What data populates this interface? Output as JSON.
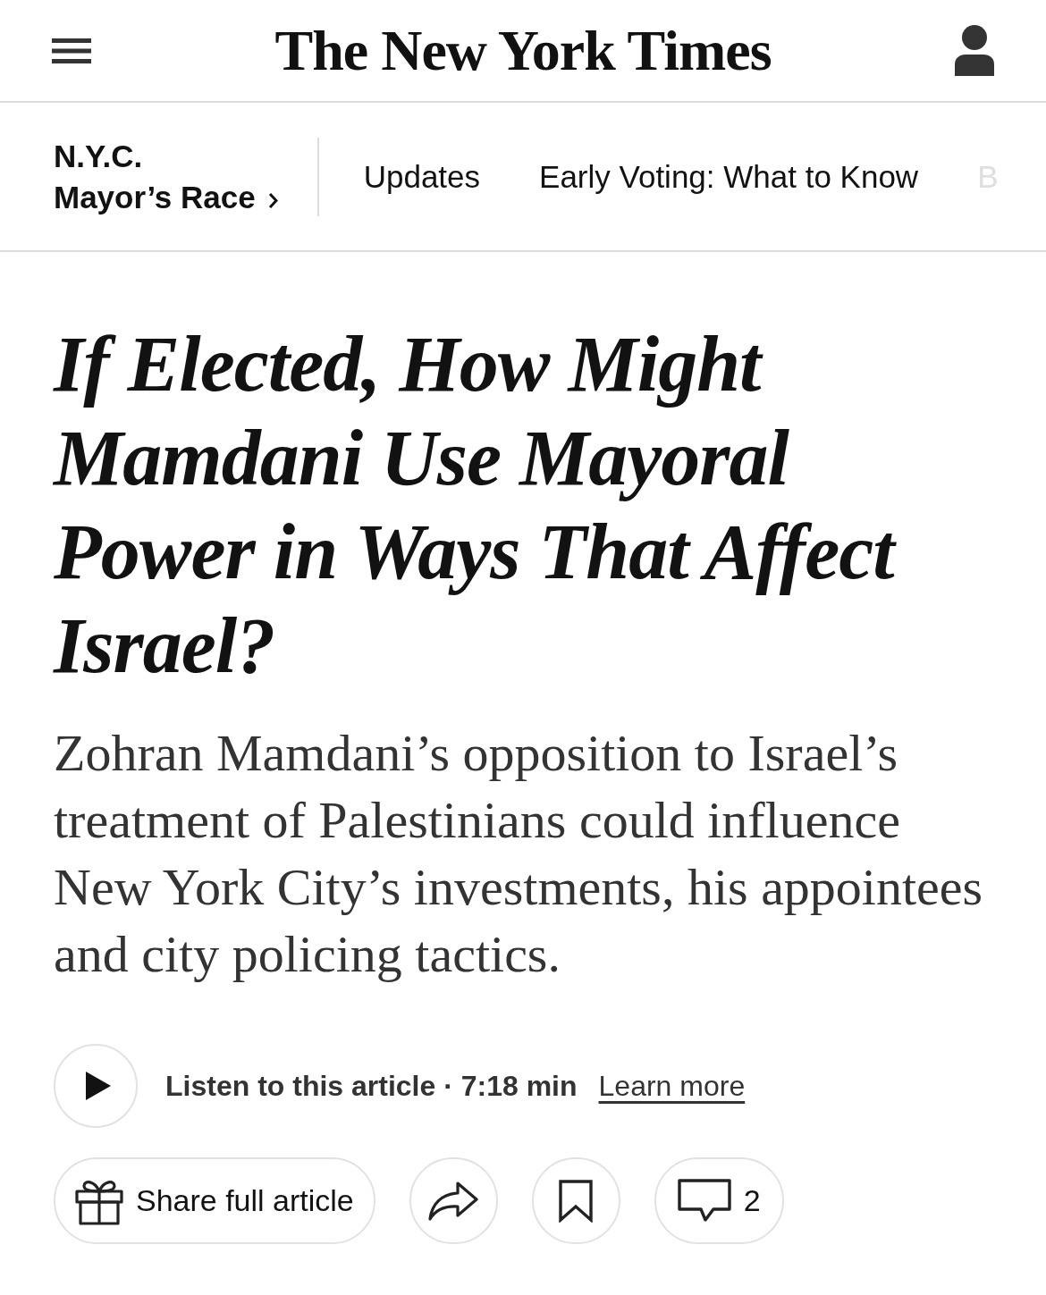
{
  "masthead": {
    "logo": "The New York Times"
  },
  "section_nav": {
    "section": [
      "N.Y.C.",
      "Mayor’s Race"
    ],
    "items": [
      {
        "label": "Updates",
        "faded": false
      },
      {
        "label": "Early Voting: What to Know",
        "faded": false
      },
      {
        "label": "B",
        "faded": true
      }
    ]
  },
  "article": {
    "headline": "If Elected, How Might Mamdani Use Mayoral Power in Ways That Affect Israel?",
    "summary": "Zohran Mamdani’s opposition to Israel’s treatment of Palestinians could influence New York City’s investments, his appointees and city policing tactics.",
    "audio": {
      "label": "Listen to this article · 7:18 min",
      "link": "Learn more"
    },
    "actions": [
      {
        "kind": "gift",
        "label": "Share full article"
      },
      {
        "kind": "share"
      },
      {
        "kind": "save"
      },
      {
        "kind": "comments",
        "count": "2"
      }
    ]
  }
}
